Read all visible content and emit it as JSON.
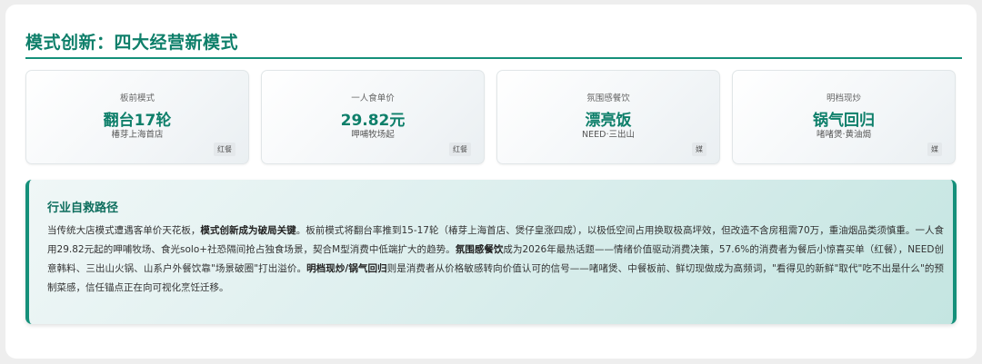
{
  "header": {
    "title": "模式创新：四大经营新模式"
  },
  "metrics": [
    {
      "label": "板前模式",
      "value": "翻台17轮",
      "sub": "椿芽上海首店",
      "tag": "红餐"
    },
    {
      "label": "一人食单价",
      "value": "29.82元",
      "sub": "呷哺牧场起",
      "tag": "红餐"
    },
    {
      "label": "氛围感餐饮",
      "value": "漂亮饭",
      "sub": "NEED·三出山",
      "tag": "媒"
    },
    {
      "label": "明档现炒",
      "value": "锅气回归",
      "sub": "啫啫煲·黄油焗",
      "tag": "媒"
    }
  ],
  "panel": {
    "title": "行业自救路径",
    "segments": [
      "当传统大店模式遭遇客单价天花板，",
      "模式创新成为破局关键",
      "。板前模式将翻台率推到15-17轮（椿芽上海首店、煲仔皇涨四成），以极低空间占用换取极高坪效，但改造不含房租需70万，重油烟品类须慎重。一人食用29.82元起的呷哺牧场、食光solo+社恐隔间抢占独食场景，契合M型消费中低端扩大的趋势。",
      "氛围感餐饮",
      "成为2026年最热话题——情绪价值驱动消费决策，57.6%的消费者为餐后小惊喜买单（红餐），NEED创意韩料、三出山火锅、山系户外餐饮靠\"场景破圈\"打出溢价。",
      "明档现炒/锅气回归",
      "则是消费者从价格敏感转向价值认可的信号——啫啫煲、中餐板前、鲜切现做成为高频词，\"看得见的新鲜\"取代\"吃不出是什么\"的预制菜感，信任锚点正在向可视化烹饪迁移。"
    ]
  }
}
